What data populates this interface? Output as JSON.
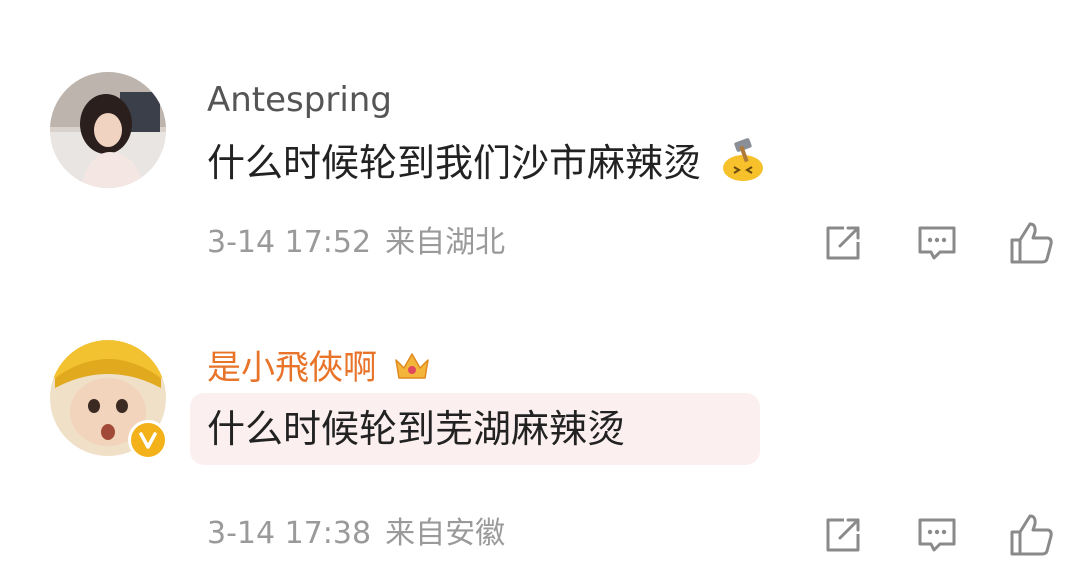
{
  "comments": [
    {
      "username": "Antespring",
      "text": "什么时候轮到我们沙市麻辣烫",
      "emoji": "hammer-face-emoji",
      "time": "3-14 17:52",
      "location": "来自湖北",
      "username_color": "#555555"
    },
    {
      "username": "是小飛俠啊",
      "text": "什么时候轮到芜湖麻辣烫",
      "badge": "crown-icon",
      "verified": "verified-v-icon",
      "time": "3-14 17:38",
      "location": "来自安徽",
      "username_color": "#e8742a"
    }
  ],
  "icons": [
    "share-icon",
    "comment-icon",
    "like-icon"
  ]
}
